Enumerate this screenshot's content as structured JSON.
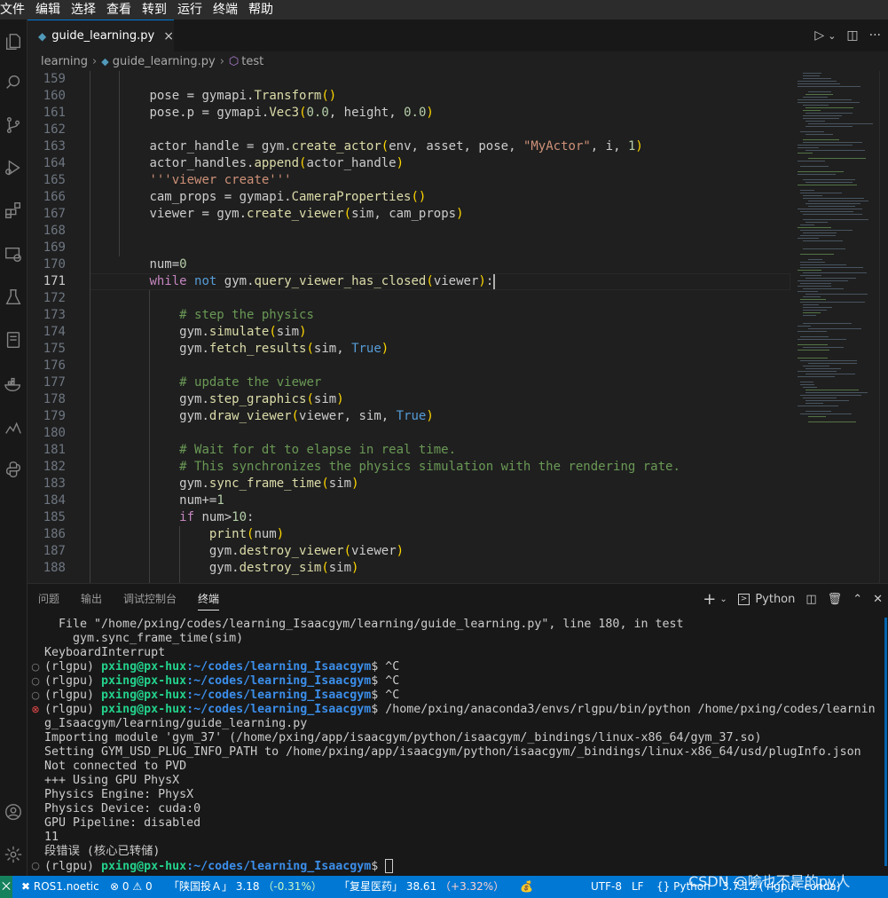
{
  "menu": [
    "文件",
    "编辑",
    "选择",
    "查看",
    "转到",
    "运行",
    "终端",
    "帮助"
  ],
  "tab": {
    "filename": "guide_learning.py",
    "close": "×",
    "run": "▷",
    "chevron": "⌄",
    "split": "◫",
    "more": "···"
  },
  "breadcrumb": {
    "folder": "learning",
    "file": "guide_learning.py",
    "symbol": "test"
  },
  "editor": {
    "line_numbers": [
      "159",
      "160",
      "161",
      "162",
      "163",
      "164",
      "165",
      "166",
      "167",
      "168",
      "169",
      "170",
      "171",
      "172",
      "173",
      "174",
      "175",
      "176",
      "177",
      "178",
      "179",
      "180",
      "181",
      "182",
      "183",
      "184",
      "185",
      "186",
      "187",
      "188"
    ],
    "current_line": "171"
  },
  "panel": {
    "tabs": [
      "问题",
      "输出",
      "调试控制台",
      "终端"
    ],
    "add": "+",
    "shell": "Python",
    "terminal_lines": [
      "  File \"/home/pxing/codes/learning_Isaacgym/learning/guide_learning.py\", line 180, in test",
      "    gym.sync_frame_time(sim)",
      "KeyboardInterrupt",
      "(rlgpu) ",
      "(rlgpu) ",
      "(rlgpu) ",
      "(rlgpu) ",
      "g_Isaacgym/learning/guide_learning.py",
      "Importing module 'gym_37' (/home/pxing/app/isaacgym/python/isaacgym/_bindings/linux-x86_64/gym_37.so)",
      "Setting GYM_USD_PLUG_INFO_PATH to /home/pxing/app/isaacgym/python/isaacgym/_bindings/linux-x86_64/usd/plugInfo.json",
      "Not connected to PVD",
      "+++ Using GPU PhysX",
      "Physics Engine: PhysX",
      "Physics Device: cuda:0",
      "GPU Pipeline: disabled",
      "11",
      "段错误 (核心已转储)",
      "(rlgpu) "
    ],
    "prompt_user": "pxing@px-hux",
    "prompt_path": ":~/codes/learning_Isaacgym",
    "prompt_sym": "$ ",
    "ctrl_c": "^C",
    "run_cmd": "/home/pxing/anaconda3/envs/rlgpu/bin/python /home/pxing/codes/learnin"
  },
  "statusbar": {
    "ros": "ROS1.noetic",
    "errors": "0",
    "warnings": "0",
    "stock1_name": "「陕国投Ａ」",
    "stock1_price": "3.18",
    "stock1_change": "（-0.31%）",
    "stock2_name": "「复星医药」",
    "stock2_price": "38.61",
    "stock2_change": "（+3.32%）",
    "encoding": "UTF-8",
    "eol": "LF",
    "language": "Python",
    "interpreter": "3.7.12 ('rlgpu': conda)"
  },
  "watermark": "CSDN @喻也不是的py人",
  "colors": {
    "accent": "#0078d4",
    "prompt_green": "#23d18b",
    "prompt_blue": "#3b8eea",
    "error_red": "#f14c4c"
  }
}
